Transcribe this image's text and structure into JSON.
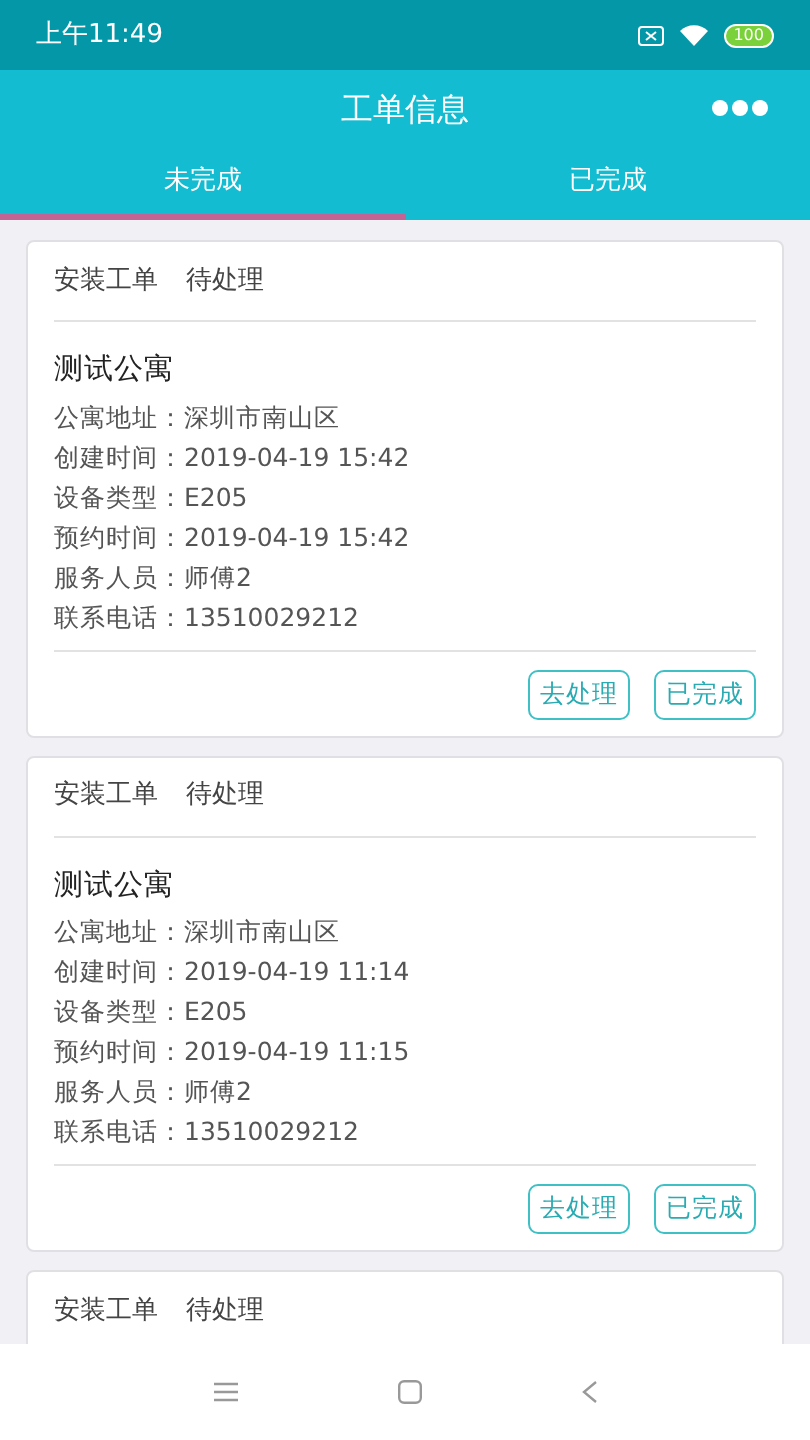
{
  "status_bar": {
    "time": "上午11:49",
    "battery": "100"
  },
  "header": {
    "title": "工单信息"
  },
  "tabs": [
    {
      "label": "未完成",
      "selected": true
    },
    {
      "label": "已完成",
      "selected": false
    }
  ],
  "orders": [
    {
      "type": "安装工单",
      "status": "待处理",
      "name": "测试公寓",
      "lines": [
        "公寓地址：深圳市南山区",
        "创建时间：2019-04-19 15:42",
        "设备类型：E205",
        "预约时间：2019-04-19 15:42",
        "服务人员：师傅2",
        "联系电话：13510029212"
      ],
      "buttons": [
        "去处理",
        "已完成"
      ]
    },
    {
      "type": "安装工单",
      "status": "待处理",
      "name": "测试公寓",
      "lines": [
        "公寓地址：深圳市南山区",
        "创建时间：2019-04-19 11:14",
        "设备类型：E205",
        "预约时间：2019-04-19 11:15",
        "服务人员：师傅2",
        "联系电话：13510029212"
      ],
      "buttons": [
        "去处理",
        "已完成"
      ]
    },
    {
      "type": "安装工单",
      "status": "待处理"
    }
  ]
}
